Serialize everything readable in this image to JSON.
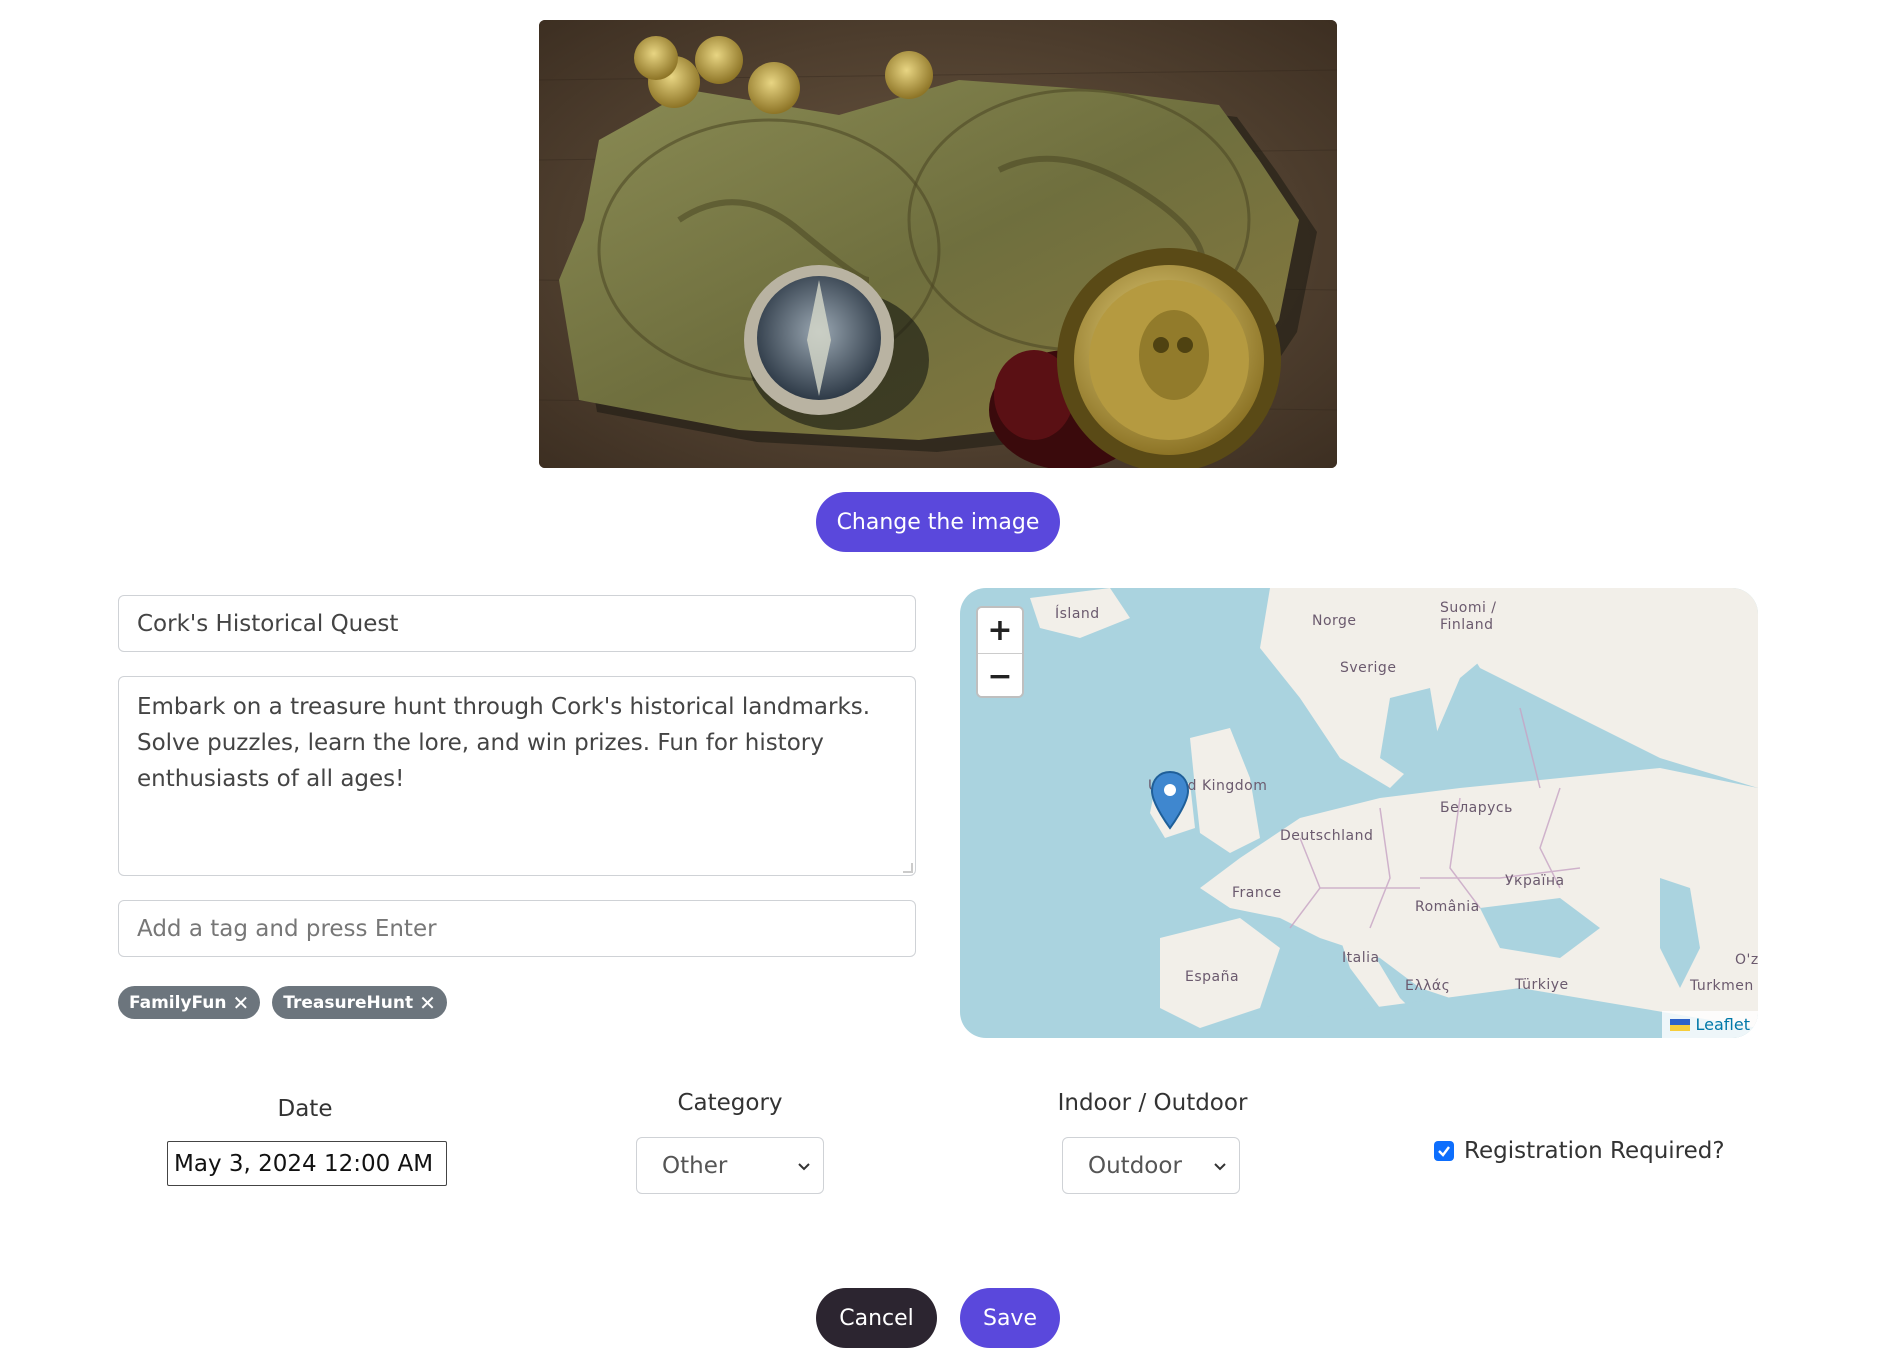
{
  "hero": {
    "change_image_label": "Change the image"
  },
  "form": {
    "title_value": "Cork's Historical Quest",
    "description_value": "Embark on a treasure hunt through Cork's historical landmarks. Solve puzzles, learn the lore, and win prizes. Fun for history enthusiasts of all ages!",
    "tag_placeholder": "Add a tag and press Enter",
    "tags": [
      "FamilyFun",
      "TreasureHunt"
    ]
  },
  "map": {
    "zoom_in": "+",
    "zoom_out": "−",
    "labels": {
      "island": "Ísland",
      "norge": "Norge",
      "suomi": "Suomi /",
      "finland": "Finland",
      "sverige": "Sverige",
      "uk": "United Kingdom",
      "belarus": "Беларусь",
      "deutschland": "Deutschland",
      "ukraina": "Україна",
      "france": "France",
      "romania": "România",
      "italia": "Italia",
      "espana": "España",
      "ellas": "Ελλάς",
      "turkiye": "Türkiye",
      "oz": "O'z",
      "turkmen": "Turkmen"
    },
    "attribution": "Leaflet"
  },
  "controls": {
    "date_label": "Date",
    "date_value": "May 3, 2024 12:00 AM",
    "category_label": "Category",
    "category_value": "Other",
    "io_label": "Indoor / Outdoor",
    "io_value": "Outdoor",
    "registration_label": "Registration Required?",
    "registration_checked": true
  },
  "actions": {
    "cancel_label": "Cancel",
    "save_label": "Save"
  },
  "colors": {
    "primary": "#5a48dc",
    "dark": "#2c2530",
    "tag_bg": "#6c757d",
    "map_water": "#aad3df",
    "checkbox": "#0d6efd"
  }
}
